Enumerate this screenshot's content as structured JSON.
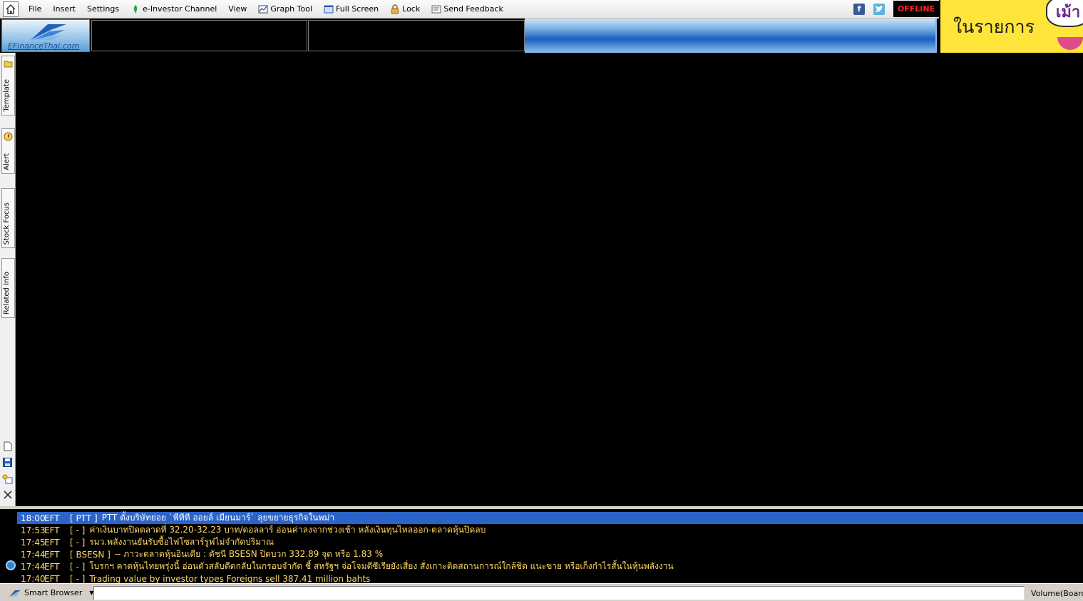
{
  "menu": {
    "items": [
      {
        "name": "menu-file",
        "label": "File"
      },
      {
        "name": "menu-insert",
        "label": "Insert"
      },
      {
        "name": "menu-settings",
        "label": "Settings"
      },
      {
        "name": "menu-e-investor-channel",
        "label": "e-Investor Channel",
        "icon": "e-investor-icon"
      },
      {
        "name": "menu-view",
        "label": "View"
      },
      {
        "name": "menu-graph-tool",
        "label": "Graph Tool",
        "icon": "graph-tool-icon"
      },
      {
        "name": "menu-full-screen",
        "label": "Full Screen",
        "icon": "full-screen-icon"
      },
      {
        "name": "menu-lock",
        "label": "Lock",
        "icon": "lock-icon"
      },
      {
        "name": "menu-send-feedback",
        "label": "Send Feedback",
        "icon": "feedback-icon"
      }
    ],
    "status": "OFFLINE",
    "status_color": "#ff2323"
  },
  "header": {
    "logo_text": "EFinanceThai.com"
  },
  "ad": {
    "text": "ในรายการ",
    "bubble_text": "เม้า"
  },
  "side_tabs": [
    {
      "name": "side-tab-template",
      "label": "Template",
      "icon": "folder-icon"
    },
    {
      "name": "side-tab-alert",
      "label": "Alert",
      "icon": "alert-icon"
    },
    {
      "name": "side-tab-stock-focus",
      "label": "Stock Focus"
    },
    {
      "name": "side-tab-related-info",
      "label": "Related Info"
    }
  ],
  "side_tools": [
    "new-document-icon",
    "save-icon",
    "layout-icon",
    "close-icon"
  ],
  "news": [
    {
      "time": "18:00",
      "source": "EFT",
      "symbol": "[ PTT ]",
      "text": "PTT ตั้งบริษัทย่อย `พีทีที ออยล์ เมียนมาร์` ลุยขยายธุรกิจในพม่า",
      "selected": true
    },
    {
      "time": "17:53",
      "source": "EFT",
      "symbol": "[ - ]",
      "text": "ค่าเงินบาทปิดตลาดที่ 32.20-32.23 บาท/ดอลลาร์ อ่อนค่าลงจากช่วงเช้า หลังเงินทุนไหลออก-ตลาดหุ้นปิดลบ",
      "selected": false
    },
    {
      "time": "17:45",
      "source": "EFT",
      "symbol": "[ - ]",
      "text": "รมว.พลังงานยันรับซื้อไฟโซลาร์รูฟไม่จำกัดปริมาณ",
      "selected": false
    },
    {
      "time": "17:44",
      "source": "EFT",
      "symbol": "[ BSESN ]",
      "text": "-- ภาวะตลาดหุ้นอินเดีย : ดัชนี BSESN  ปิดบวก   332.89 จุด หรือ 1.83 %",
      "selected": false
    },
    {
      "time": "17:44",
      "source": "EFT",
      "symbol": "[ - ]",
      "text": "โบรกฯ คาดหุ้นไทยพรุ่งนี้ อ่อนตัวสลับดีดกลับในกรอบจำกัด ชี้ สหรัฐฯ จ่อโจมตีซีเรียยังเสี่ยง สั่งเกาะติดสถานการณ์ใกล้ชิด แนะขาย หรือเก็งกำไรสั้นในหุ้นพลังงาน",
      "selected": false
    },
    {
      "time": "17:40",
      "source": "EFT",
      "symbol": "[ - ]",
      "text": "Trading value by investor types Foreigns sell 387.41 million bahts",
      "selected": false
    }
  ],
  "statusbar": {
    "smart_browser_label": "Smart Browser",
    "url_value": "",
    "volume_label": "Volume(Board l"
  }
}
